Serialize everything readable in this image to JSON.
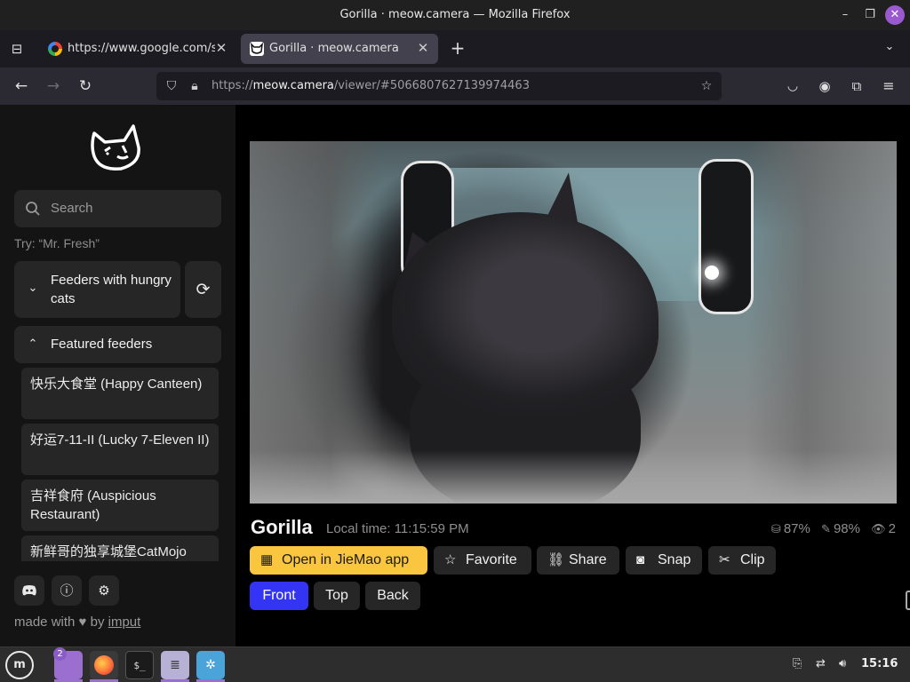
{
  "window": {
    "title": "Gorilla · meow.camera — Mozilla Firefox"
  },
  "tabs": [
    {
      "title": "https://www.google.com/se",
      "favicon": "google-favicon"
    },
    {
      "title": "Gorilla · meow.camera",
      "favicon": "meow-camera-favicon",
      "active": true
    }
  ],
  "navbar": {
    "url_prefix": "https://",
    "url_host": "meow.camera",
    "url_path": "/viewer/#5066807627139974463"
  },
  "sidebar": {
    "search_placeholder": "Search",
    "hint": "Try: “Mr. Fresh”",
    "hungry_label": "Feeders with hungry cats",
    "featured_label": "Featured feeders",
    "featured_items": [
      {
        "label": "快乐大食堂 (Happy Canteen)"
      },
      {
        "label": "好运7-11-II (Lucky 7-Eleven II)"
      },
      {
        "label": "吉祥食府 (Auspicious Restaurant)"
      },
      {
        "label": "新鲜哥的独享城堡CatMojo"
      }
    ],
    "footer_made": "made with",
    "footer_by": "by",
    "footer_link": "imput"
  },
  "camera": {
    "name": "Gorilla",
    "local_time": "Local time: 11:15:59 PM",
    "stats": {
      "food": "87%",
      "battery": "98%",
      "viewers": "2"
    }
  },
  "actions": {
    "open": "Open in JieMao app",
    "favorite": "Favorite",
    "share": "Share",
    "snap": "Snap",
    "clip": "Clip"
  },
  "views": [
    {
      "label": "Front",
      "active": true
    },
    {
      "label": "Top",
      "active": false
    },
    {
      "label": "Back",
      "active": false
    }
  ],
  "taskbar": {
    "files_badge": "2",
    "terminal_label": "$_",
    "clock": "15:16"
  },
  "colors": {
    "accent_yellow": "#fac53f",
    "accent_blue": "#3434f5",
    "purple": "#9b6fd0"
  }
}
